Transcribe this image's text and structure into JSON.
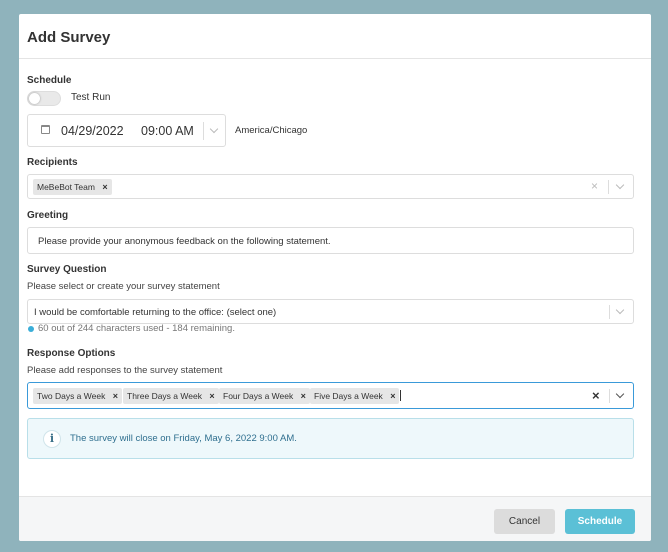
{
  "modal": {
    "title": "Add Survey"
  },
  "schedule": {
    "label": "Schedule",
    "test_run_label": "Test Run",
    "test_run_enabled": false,
    "date": "04/29/2022",
    "time": "09:00 AM",
    "timezone": "America/Chicago"
  },
  "recipients": {
    "label": "Recipients",
    "chips": [
      "MeBeBot Team"
    ]
  },
  "greeting": {
    "label": "Greeting",
    "value": "Please provide your anonymous feedback on the following statement."
  },
  "survey_question": {
    "label": "Survey Question",
    "helper": "Please select or create your survey statement",
    "value": "I would be comfortable returning to the office: (select one)",
    "char_count": "60 out of 244 characters used - 184 remaining."
  },
  "response_options": {
    "label": "Response Options",
    "helper": "Please add responses to the survey statement",
    "chips": [
      "Two Days a Week",
      "Three Days a Week",
      "Four Days a Week",
      "Five Days a Week"
    ]
  },
  "info": {
    "icon": "i",
    "text": "The survey will close on Friday, May 6, 2022 9:00 AM."
  },
  "footer": {
    "cancel_label": "Cancel",
    "schedule_label": "Schedule"
  },
  "chip_remove": "×",
  "colors": {
    "backdrop": "#8fb3bc",
    "accent": "#5bc0d6",
    "focus_border": "#3a9ad9",
    "info_text": "#2f6f8f"
  }
}
